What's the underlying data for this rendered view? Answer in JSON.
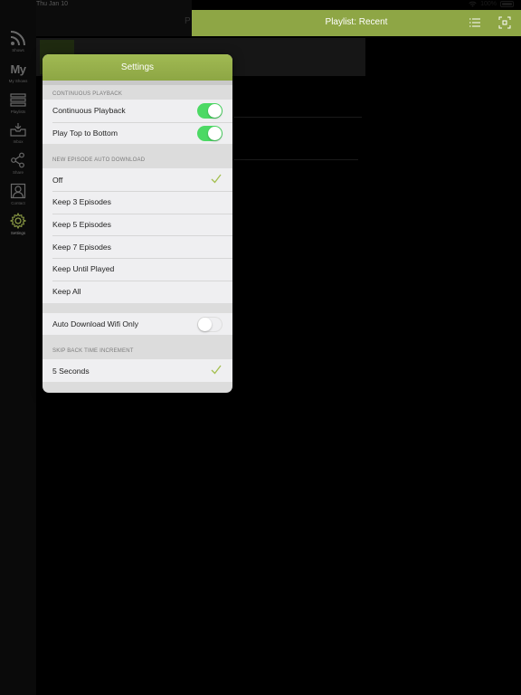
{
  "status_bar": {
    "time": "Thu Jan 10",
    "battery": "100%"
  },
  "sidebar": {
    "items": [
      {
        "label": "Shows",
        "icon": "rss-icon"
      },
      {
        "label": "My Shows",
        "icon": "my-shows-icon",
        "text": "My"
      },
      {
        "label": "Playlists",
        "icon": "playlist-icon"
      },
      {
        "label": "Inbox",
        "icon": "inbox-icon"
      },
      {
        "label": "Share",
        "icon": "share-icon"
      },
      {
        "label": "Contact",
        "icon": "contact-icon"
      },
      {
        "label": "Settings",
        "icon": "gear-icon"
      }
    ],
    "active": "Settings"
  },
  "header": {
    "title": "Playlist: Recent",
    "left_letter": "P"
  },
  "settings": {
    "title": "Settings",
    "sections": {
      "continuous": {
        "header": "CONTINUOUS PLAYBACK",
        "rows": [
          {
            "label": "Continuous Playback",
            "on": true
          },
          {
            "label": "Play Top to Bottom",
            "on": true
          }
        ]
      },
      "auto_download": {
        "header": "NEW EPISODE AUTO DOWNLOAD",
        "options": [
          "Off",
          "Keep 3 Episodes",
          "Keep 5 Episodes",
          "Keep 7 Episodes",
          "Keep Until Played",
          "Keep All"
        ],
        "selected": "Off"
      },
      "wifi": {
        "label": "Auto Download Wifi Only",
        "on": false
      },
      "skip_back": {
        "header": "SKIP BACK TIME INCREMENT",
        "options": [
          "5 Seconds"
        ],
        "selected": "5 Seconds"
      }
    }
  },
  "colors": {
    "accent": "#8ea645",
    "toggle_on": "#4cd964",
    "check": "#a4bf4f"
  }
}
